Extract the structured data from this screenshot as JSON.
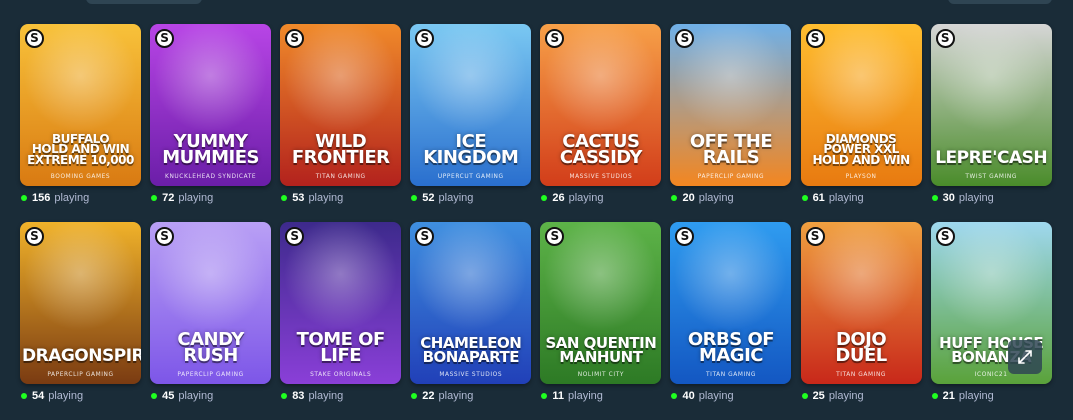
{
  "colors": {
    "background": "#1a2c38",
    "online_dot": "#1fff20",
    "muted_text": "#b1bad3"
  },
  "badge_icon": "stake-s-badge-icon",
  "games": [
    {
      "title_lines": [
        "BUFFALO",
        "HOLD AND WIN",
        "EXTREME 10,000"
      ],
      "provider": "BOOMING GAMES",
      "players": "156",
      "playing_label": "playing",
      "bg": [
        "#f8c23a",
        "#d97a12"
      ]
    },
    {
      "title_lines": [
        "YUMMY",
        "MUMMIES"
      ],
      "provider": "KNUCKLEHEAD SYNDICATE",
      "players": "72",
      "playing_label": "playing",
      "bg": [
        "#b845e6",
        "#6b1ea8"
      ]
    },
    {
      "title_lines": [
        "WILD",
        "FRONTIER"
      ],
      "provider": "TITAN GAMING",
      "players": "53",
      "playing_label": "playing",
      "bg": [
        "#f08a2a",
        "#b3221d"
      ]
    },
    {
      "title_lines": [
        "ICE",
        "KINGDOM"
      ],
      "provider": "UPPERCUT GAMING",
      "players": "52",
      "playing_label": "playing",
      "bg": [
        "#7ac8f2",
        "#2a6fce"
      ]
    },
    {
      "title_lines": [
        "CACTUS",
        "CASSIDY"
      ],
      "provider": "MASSIVE STUDIOS",
      "players": "26",
      "playing_label": "playing",
      "bg": [
        "#f7a048",
        "#d23d1a"
      ]
    },
    {
      "title_lines": [
        "OFF THE",
        "RAILS"
      ],
      "provider": "PAPERCLIP GAMING",
      "players": "20",
      "playing_label": "playing",
      "bg": [
        "#6fb0e8",
        "#f38620"
      ]
    },
    {
      "title_lines": [
        "DIAMONDS",
        "POWER XXL",
        "HOLD AND WIN"
      ],
      "provider": "PLAYSON",
      "players": "61",
      "playing_label": "playing",
      "bg": [
        "#ffbe30",
        "#e87a10"
      ]
    },
    {
      "title_lines": [
        "LEPRE'CASH"
      ],
      "provider": "TWIST GAMING",
      "players": "30",
      "playing_label": "playing",
      "bg": [
        "#d6d6d6",
        "#4a8c2a"
      ]
    },
    {
      "title_lines": [
        "DRAGONSPIRE"
      ],
      "provider": "PAPERCLIP GAMING",
      "players": "54",
      "playing_label": "playing",
      "bg": [
        "#f0b22a",
        "#7a3b12"
      ]
    },
    {
      "title_lines": [
        "CANDY",
        "RUSH"
      ],
      "provider": "PAPERCLIP GAMING",
      "players": "45",
      "playing_label": "playing",
      "bg": [
        "#b9a0f5",
        "#7d56e8"
      ]
    },
    {
      "title_lines": [
        "TOME OF",
        "LIFE"
      ],
      "provider": "STAKE ORIGINALS",
      "players": "83",
      "playing_label": "playing",
      "bg": [
        "#3d2a8c",
        "#8a3fd8"
      ]
    },
    {
      "title_lines": [
        "CHAMELEON",
        "BONAPARTE"
      ],
      "provider": "MASSIVE STUDIOS",
      "players": "22",
      "playing_label": "playing",
      "bg": [
        "#3f8fe0",
        "#2140b8"
      ]
    },
    {
      "title_lines": [
        "SAN QUENTIN",
        "MANHUNT"
      ],
      "provider": "NOLIMIT CITY",
      "players": "11",
      "playing_label": "playing",
      "bg": [
        "#5db348",
        "#2d7a25"
      ]
    },
    {
      "title_lines": [
        "ORBS OF",
        "MAGIC"
      ],
      "provider": "TITAN GAMING",
      "players": "40",
      "playing_label": "playing",
      "bg": [
        "#2f9cf0",
        "#1357c2"
      ]
    },
    {
      "title_lines": [
        "DOJO",
        "DUEL"
      ],
      "provider": "TITAN GAMING",
      "players": "25",
      "playing_label": "playing",
      "bg": [
        "#f0a040",
        "#c8281a"
      ]
    },
    {
      "title_lines": [
        "HUFF HOUSE",
        "BONANZA"
      ],
      "provider": "ICONIC21",
      "players": "21",
      "playing_label": "playing",
      "bg": [
        "#9fd8ef",
        "#5aa23a"
      ]
    }
  ],
  "expand_icon": "expand-icon"
}
